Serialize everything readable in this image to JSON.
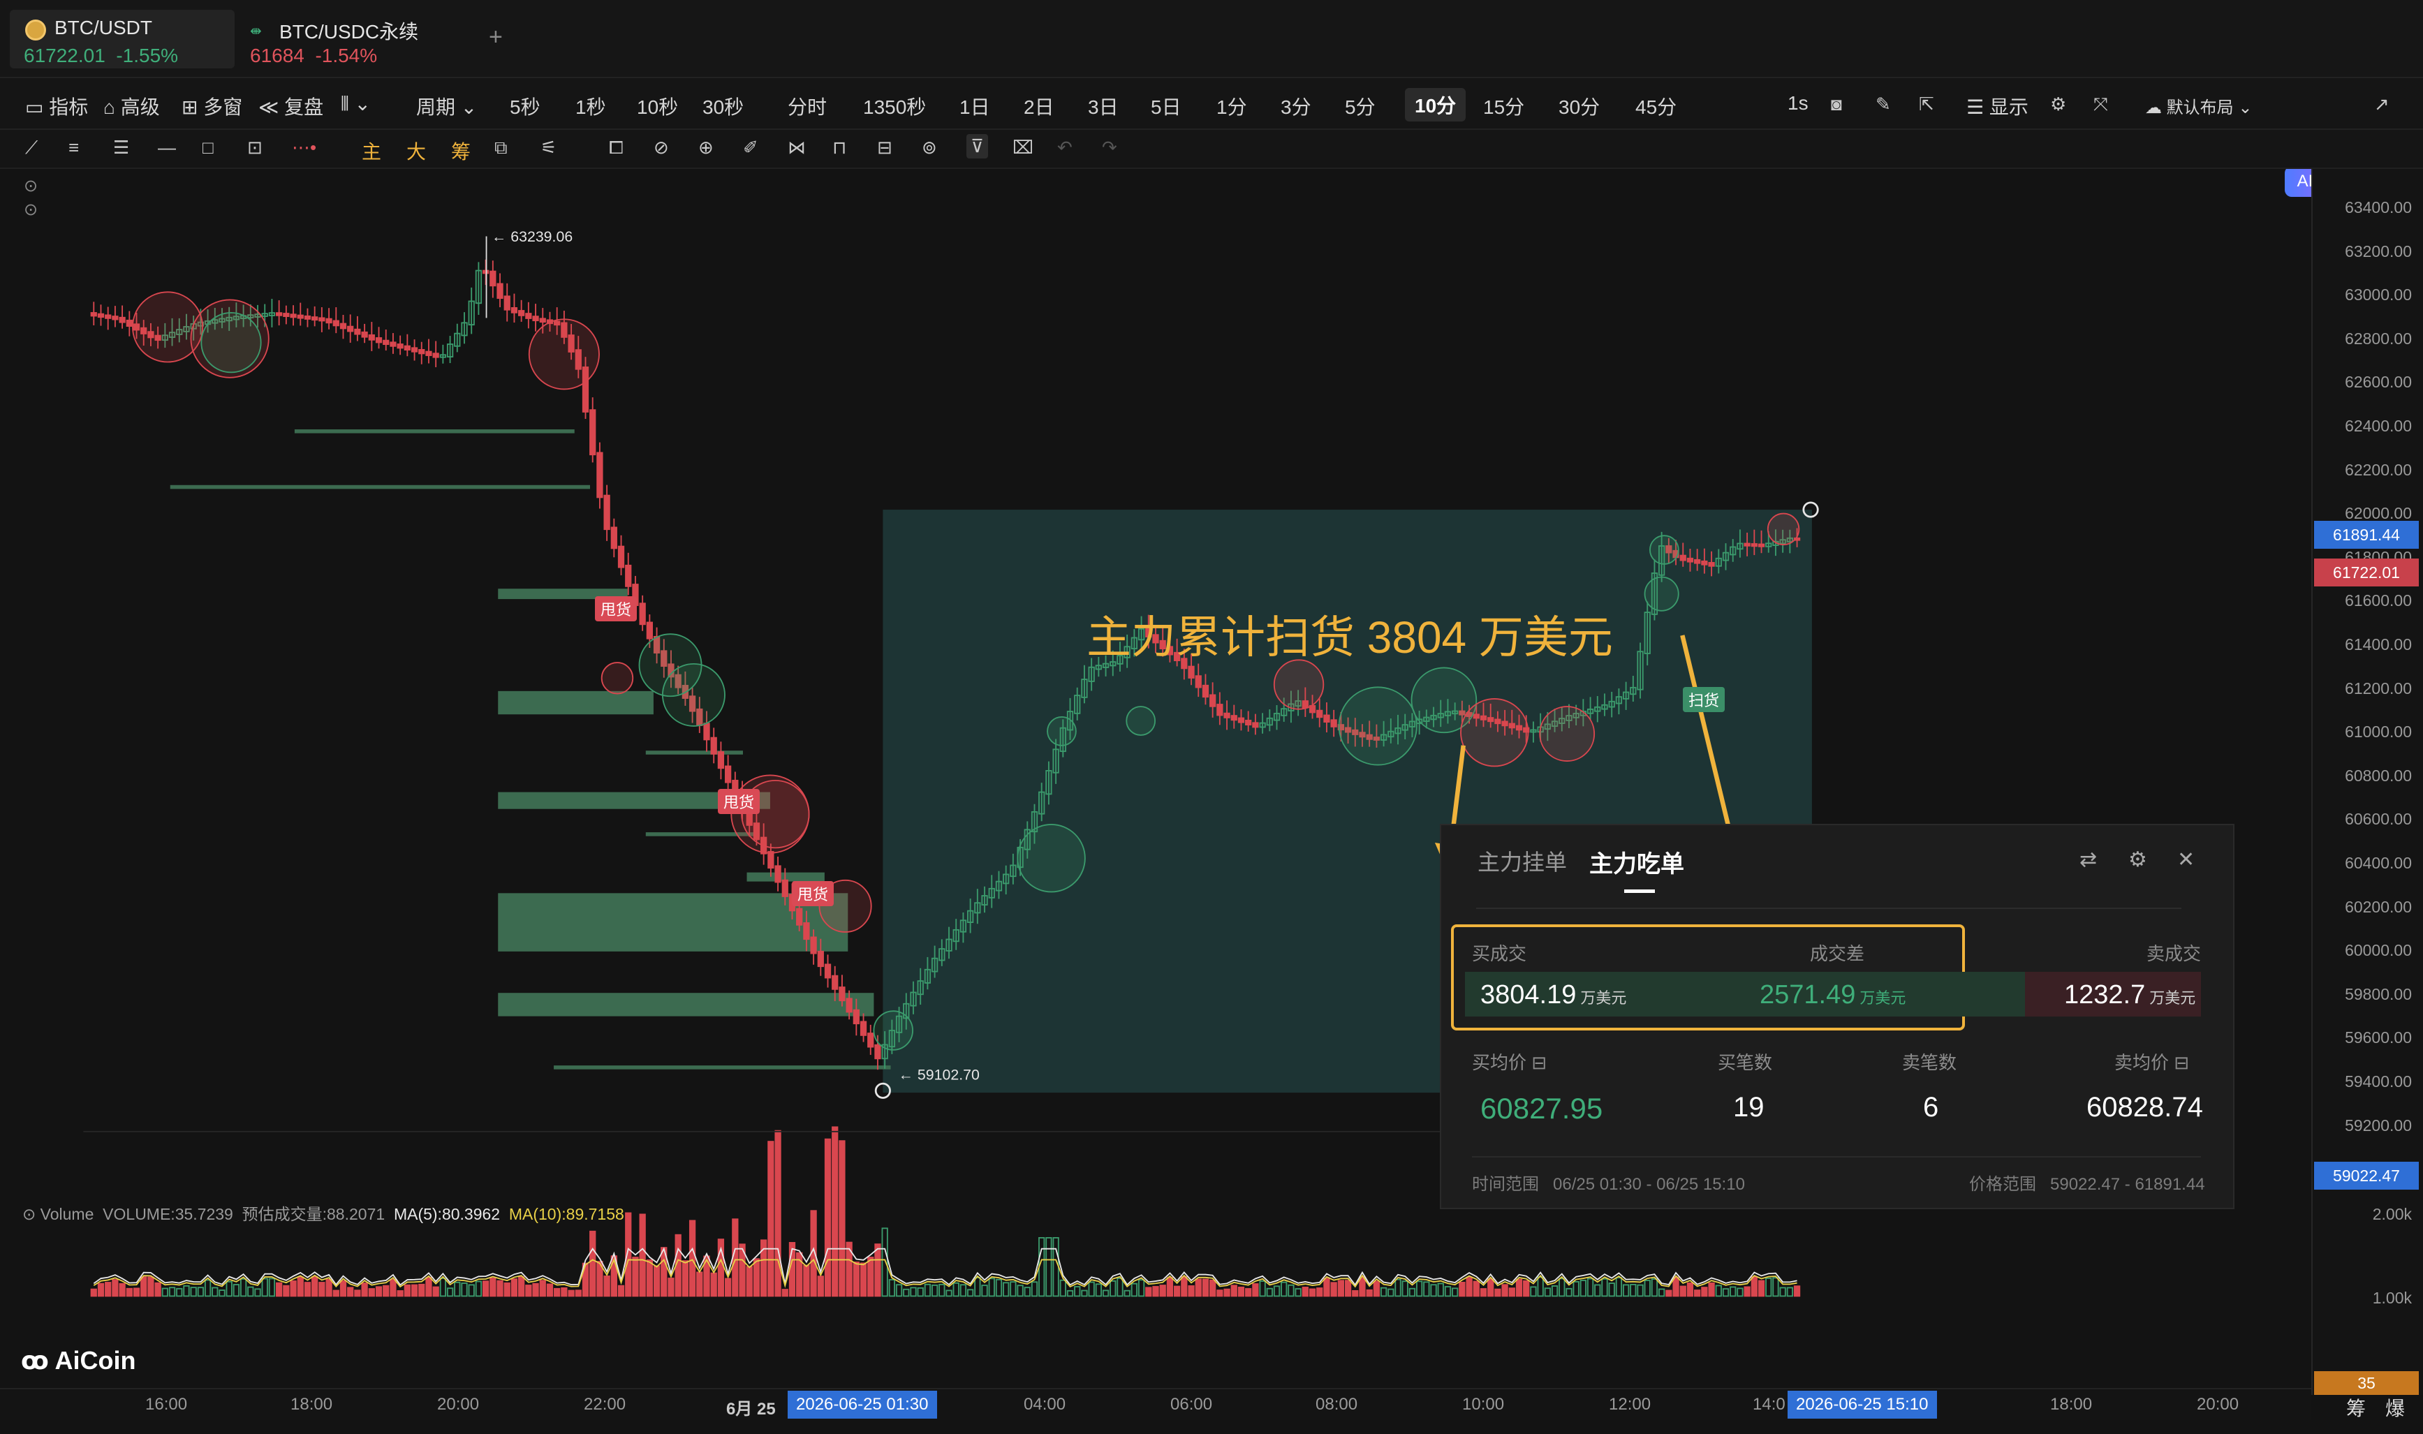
{
  "tabs": [
    {
      "symbol": "BTC/USDT",
      "price": "61722.01",
      "change": "-1.55%"
    },
    {
      "symbol": "BTC/USDC永续",
      "price": "61684",
      "change": "-1.54%"
    }
  ],
  "add_tab": "+",
  "toolbar1": {
    "indicators": "指标",
    "advanced": "高级",
    "multi": "多窗",
    "replay": "复盘",
    "period": "周期",
    "periods": [
      "5秒",
      "1秒",
      "10秒",
      "30秒",
      "分时",
      "1350秒",
      "1日",
      "2日",
      "3日",
      "5日",
      "1分",
      "3分",
      "5分",
      "10分",
      "15分",
      "30分",
      "45分"
    ],
    "active_period": "10分",
    "interval": "1s",
    "display": "显示",
    "layout": "默认布局",
    "ai": "AI解读"
  },
  "toolbar2": {
    "main": "主",
    "big": "大",
    "chip": "筹"
  },
  "price_axis": {
    "ticks": [
      "63400.00",
      "63200.00",
      "63000.00",
      "62800.00",
      "62600.00",
      "62400.00",
      "62200.00",
      "62000.00",
      "61800.00",
      "61600.00",
      "61400.00",
      "61200.00",
      "61000.00",
      "60800.00",
      "60600.00",
      "60400.00",
      "60200.00",
      "60000.00",
      "59800.00",
      "59600.00",
      "59400.00",
      "59200.00"
    ],
    "tag_high": "61891.44",
    "tag_last": "61722.01",
    "tag_low": "59022.47",
    "vol_ticks": [
      "2.00k",
      "1.00k"
    ],
    "vol_tag": "35"
  },
  "chart": {
    "high_label": "63239.06",
    "low_label": "59102.70",
    "headline": "主力累计扫货 3804 万美元",
    "signal_dump": "甩货",
    "signal_sweep": "扫货"
  },
  "volume_legend": {
    "name": "Volume",
    "volume": "VOLUME:35.7239",
    "est": "预估成交量:88.2071",
    "ma5": "MA(5):80.3962",
    "ma10": "MA(10):89.7158"
  },
  "time_axis": {
    "ticks": [
      "16:00",
      "18:00",
      "20:00",
      "22:00",
      "6月 25",
      "04:00",
      "06:00",
      "08:00",
      "10:00",
      "12:00",
      "14:0",
      "18:00",
      "20:00"
    ],
    "tag_start": "2026-06-25 01:30",
    "tag_end": "2026-06-25 15:10"
  },
  "logo": "AiCoin",
  "panel": {
    "tab1": "主力挂单",
    "tab2": "主力吃单",
    "buy_label": "买成交",
    "diff_label": "成交差",
    "sell_label": "卖成交",
    "buy_value": "3804.19",
    "diff_value": "2571.49",
    "sell_value": "1232.7",
    "unit": "万美元",
    "avg_buy_label": "买均价",
    "buy_count_label": "买笔数",
    "sell_count_label": "卖笔数",
    "avg_sell_label": "卖均价",
    "avg_buy": "60827.95",
    "buy_count": "19",
    "sell_count": "6",
    "avg_sell": "60828.74",
    "time_range_label": "时间范围",
    "time_range": "06/25 01:30 - 06/25 15:10",
    "price_range_label": "价格范围",
    "price_range": "59022.47 - 61891.44"
  },
  "bottom_right": {
    "chip": "筹",
    "burst": "爆"
  },
  "colors": {
    "up": "#3b9a6c",
    "down": "#d9474f",
    "accent": "#f0b33c",
    "box": "#1d3434"
  }
}
